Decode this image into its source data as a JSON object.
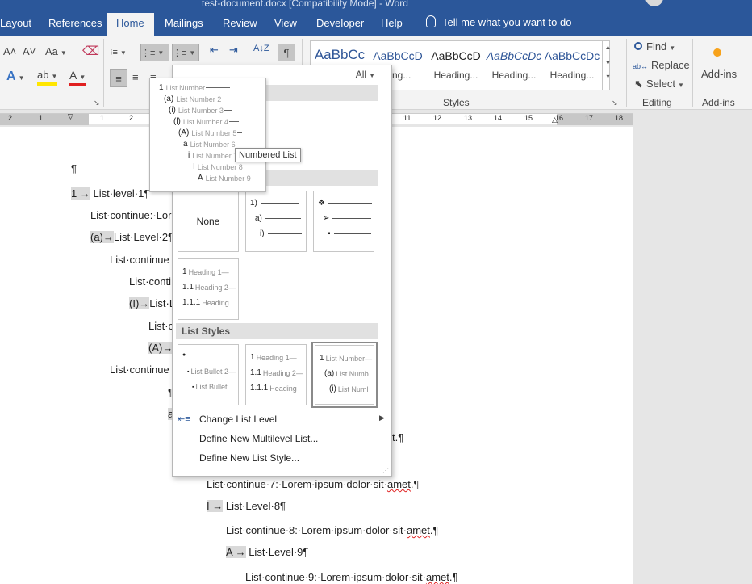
{
  "window": {
    "title": "test-document.docx [Compatibility Mode] - Word"
  },
  "tabs": [
    {
      "label": "Layout"
    },
    {
      "label": "References"
    },
    {
      "label": "Home"
    },
    {
      "label": "Mailings"
    },
    {
      "label": "Review"
    },
    {
      "label": "View"
    },
    {
      "label": "Developer"
    },
    {
      "label": "Help"
    }
  ],
  "tell_me": {
    "placeholder": "Tell me what you want to do"
  },
  "ribbon": {
    "font": {
      "grow": "A˄",
      "shrink": "A˅",
      "case": "Aa",
      "effects": "A",
      "highlight": "ab",
      "color": "A"
    },
    "paragraph": {
      "sort": "A↓Z",
      "pilcrow": "¶"
    },
    "styles": {
      "items": [
        {
          "sample": "AaBbCc",
          "name": ""
        },
        {
          "sample": "AaBbCcD",
          "name": "ding..."
        },
        {
          "sample": "AaBbCcD",
          "name": "Heading..."
        },
        {
          "sample": "AaBbCcDc",
          "name": "Heading..."
        },
        {
          "sample": "AaBbCcDc",
          "name": "Heading..."
        }
      ],
      "group_label": "Styles"
    },
    "editing": {
      "find": "Find",
      "replace": "Replace",
      "select": "Select",
      "group_label": "Editing"
    },
    "addins": {
      "button": "Add-ins",
      "group_label": "Add-ins"
    }
  },
  "ruler": {
    "labels": [
      "2",
      "1",
      "1",
      "2",
      "11",
      "12",
      "13",
      "14",
      "15",
      "16",
      "17",
      "18"
    ]
  },
  "document": {
    "lines": [
      {
        "marker": "",
        "text": "¶"
      },
      {
        "marker": "1 →",
        "text": "List·level·1¶"
      },
      {
        "marker": "",
        "text": "List·continue:·Lor"
      },
      {
        "marker": "(a)→",
        "text": "List·Level·2¶"
      },
      {
        "marker": "",
        "text": "List·continue"
      },
      {
        "marker": "",
        "text": "List·conti"
      },
      {
        "marker": "(I)→",
        "text": "List·L"
      },
      {
        "marker": "",
        "text": "List·c"
      },
      {
        "marker": "(A)→",
        "text": "L"
      },
      {
        "marker": "",
        "text": "List·continue"
      },
      {
        "marker": "",
        "text": "¶"
      },
      {
        "marker": "",
        "text": "a"
      },
      {
        "marker": "",
        "text": "t.¶"
      },
      {
        "marker": "",
        "text": "List·continue·7:·Lorem·ipsum·dolor·sit·",
        "squiggle": "amet",
        "tail": ".¶"
      },
      {
        "marker": "I →",
        "text": "List·Level·8¶"
      },
      {
        "marker": "",
        "text": "List·continue·8:·Lorem·ipsum·dolor·sit·",
        "squiggle": "amet",
        "tail": ".¶"
      },
      {
        "marker": "A →",
        "text": "List·Level·9¶"
      },
      {
        "marker": "",
        "text": "List·continue·9:·Lorem·ipsum·dolor·sit·",
        "squiggle": "amet",
        "tail": ".¶"
      }
    ]
  },
  "dropdown": {
    "filter": "All",
    "section_list_styles": "List Styles",
    "none_label": "None",
    "library_outline": {
      "nums": [
        "1)",
        "a)",
        "i)"
      ]
    },
    "library_bullets": {
      "nums": [
        "❖",
        "➢",
        "▪"
      ]
    },
    "library_headings": {
      "rows": [
        {
          "num": "1",
          "text": "Heading 1—"
        },
        {
          "num": "1.1",
          "text": "Heading 2—"
        },
        {
          "num": "1.1.1",
          "text": "Heading"
        }
      ]
    },
    "style_bullet": {
      "rows": [
        {
          "num": "●",
          "text": ""
        },
        {
          "num": "▪",
          "text": "List Bullet 2—"
        },
        {
          "num": "▪",
          "text": "List Bullet"
        }
      ]
    },
    "style_heading": {
      "rows": [
        {
          "num": "1",
          "text": "Heading 1—"
        },
        {
          "num": "1.1",
          "text": "Heading 2—"
        },
        {
          "num": "1.1.1",
          "text": "Heading"
        }
      ]
    },
    "style_numbered": {
      "rows": [
        {
          "num": "1",
          "text": "List Number—"
        },
        {
          "num": "(a)",
          "text": "List Numb"
        },
        {
          "num": "(i)",
          "text": "List Numl"
        }
      ]
    },
    "commands": [
      {
        "label": "Change List Level",
        "has_submenu": true
      },
      {
        "label": "Define New Multilevel List...",
        "has_submenu": false
      },
      {
        "label": "Define New List Style...",
        "has_submenu": false
      }
    ]
  },
  "preview": {
    "rows": [
      {
        "num": "1",
        "text": "List Number"
      },
      {
        "num": "(a)",
        "text": "List Number 2"
      },
      {
        "num": "(i)",
        "text": "List Number 3"
      },
      {
        "num": "(l)",
        "text": "List Number 4"
      },
      {
        "num": "(A)",
        "text": "List Number 5"
      },
      {
        "num": "a",
        "text": "List Number 6"
      },
      {
        "num": "i",
        "text": "List Number 7"
      },
      {
        "num": "I",
        "text": "List Number 8"
      },
      {
        "num": "A",
        "text": "List Number 9"
      }
    ],
    "tooltip": "Numbered List"
  }
}
